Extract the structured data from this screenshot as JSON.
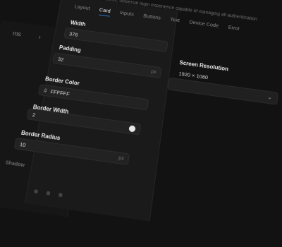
{
  "topbar": {
    "text": "CTO/I(O) is a headless, universal login experience capable of managing all authentication"
  },
  "sidebar": {
    "item_label": "ms"
  },
  "tabs": [
    {
      "label": "Layout"
    },
    {
      "label": "Card"
    },
    {
      "label": "Inputs"
    },
    {
      "label": "Buttons"
    },
    {
      "label": "Text"
    },
    {
      "label": "Device Code"
    },
    {
      "label": "Error"
    }
  ],
  "card": {
    "width": {
      "label": "Width",
      "value": "376"
    },
    "padding": {
      "label": "Padding",
      "value": "32",
      "unit": "px"
    },
    "border_color": {
      "label": "Border Color",
      "hash": "#",
      "value": "FFFFFF"
    },
    "border_width": {
      "label": "Border Width",
      "value": "2"
    },
    "border_radius": {
      "label": "Border Radius",
      "value": "10",
      "unit": "px"
    },
    "shadow_label": "Shadow"
  },
  "device": {
    "screen_resolution_label": "Screen Resolution",
    "screen_resolution_value": "1920 × 1080"
  },
  "colors": {
    "accent": "#2f7be5",
    "background": "#121212",
    "panel": "#1a1a1a"
  },
  "icons": {
    "chevron_down": "chevron-down-icon",
    "chevron_right": "chevron-right-icon",
    "toggle": "toggle-icon"
  }
}
